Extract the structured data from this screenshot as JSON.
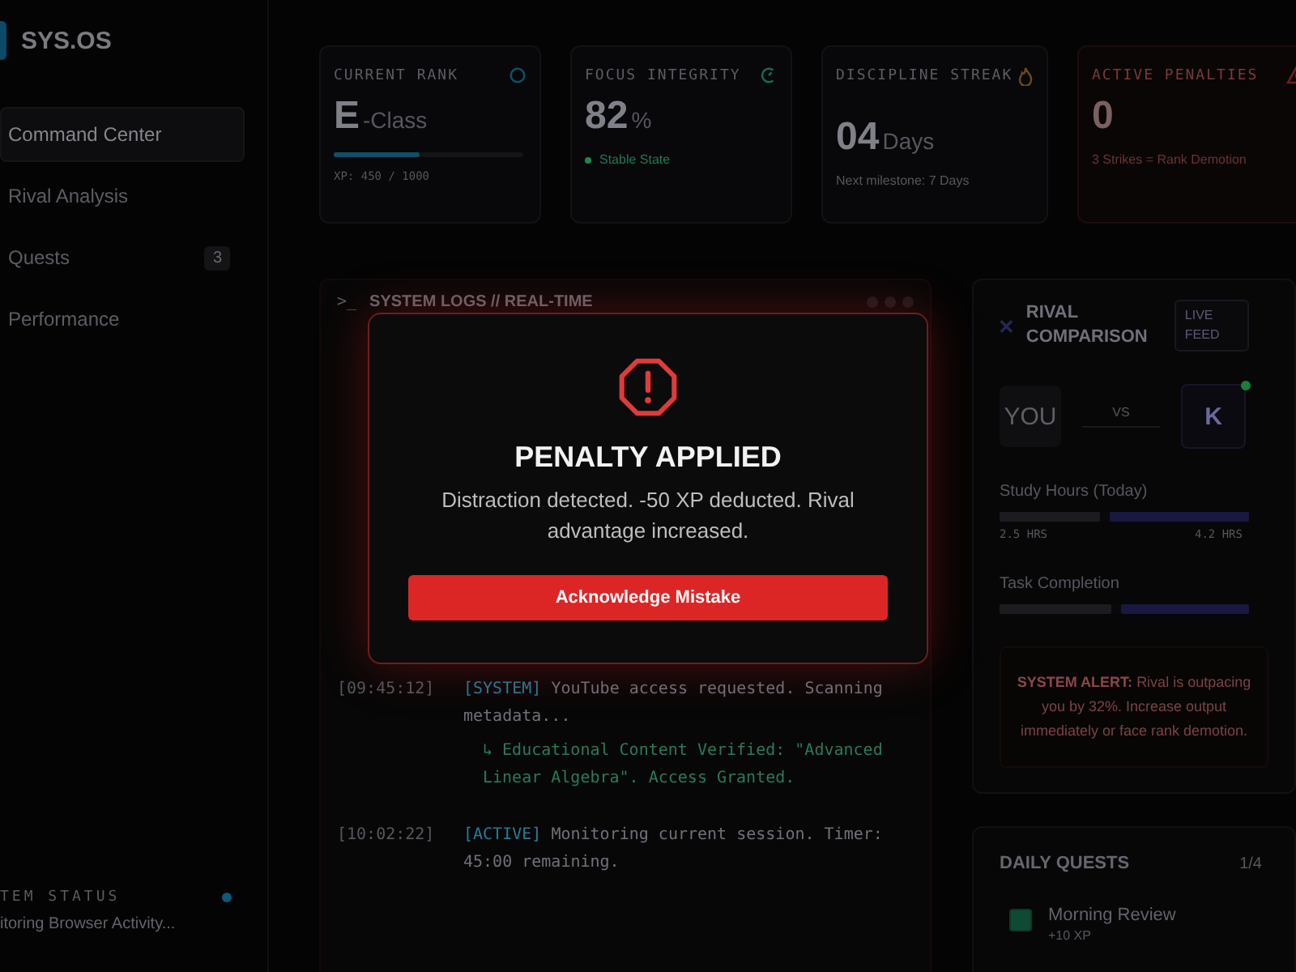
{
  "sidebar": {
    "logo": "SYS.OS",
    "items": [
      {
        "label": "Command Center",
        "selected": true
      },
      {
        "label": "Rival Analysis",
        "selected": false
      },
      {
        "label": "Quests",
        "selected": false,
        "badge": "3"
      },
      {
        "label": "Performance",
        "selected": false
      }
    ],
    "status": {
      "label": "TEM STATUS",
      "text": "itoring Browser Activity..."
    }
  },
  "stats": [
    {
      "kind": "rank",
      "label": "CURRENT RANK",
      "value": "E",
      "unit": "-Class",
      "level": 0.45,
      "note": "XP: 450 / 1000"
    },
    {
      "kind": "focus",
      "label": "FOCUS INTEGRITY",
      "value": "82",
      "unit": "%",
      "note": "Stable State"
    },
    {
      "kind": "streak",
      "label": "DISCIPLINE STREAK",
      "value": "04",
      "unit": "Days",
      "note": "Next milestone: 7 Days"
    },
    {
      "kind": "penalty",
      "label": "ACTIVE PENALTIES",
      "value": "0",
      "note": "3 Strikes = Rank Demotion"
    }
  ],
  "logs": {
    "title": "SYSTEM LOGS // REAL-TIME",
    "prompt": ">_",
    "entries": [
      {
        "time": "[09:45:12]",
        "tag": "[SYSTEM]",
        "text": "YouTube access requested. Scanning metadata...",
        "note": "↳ Educational Content Verified: \"Advanced Linear Algebra\". Access Granted."
      },
      {
        "time": "[10:02:22]",
        "tag": "[ACTIVE]",
        "text": "Monitoring current session. Timer: 45:00 remaining."
      }
    ]
  },
  "rival": {
    "title": "RIVAL COMPARISON",
    "badge": "LIVE FEED",
    "you": "YOU",
    "vs": "VS",
    "rival": "K",
    "metrics": [
      {
        "label": "Study Hours (Today)",
        "level": 0.4,
        "you_reading": "2.5 HRS",
        "rival_reading": "4.2 HRS"
      },
      {
        "label": "Task Completion",
        "level": 0.45
      }
    ],
    "alert": {
      "title": "SYSTEM ALERT:",
      "text": "Rival is outpacing you by 32%. Increase output immediately or face rank demotion."
    }
  },
  "quests": {
    "title": "DAILY QUESTS",
    "count": "1/4",
    "items": [
      {
        "label": "Morning Review",
        "reward": "+10 XP",
        "checked": true
      }
    ]
  },
  "modal": {
    "title": "PENALTY APPLIED",
    "message": "Distraction detected. -50 XP deducted. Rival advantage increased.",
    "button": "Acknowledge Mistake"
  }
}
